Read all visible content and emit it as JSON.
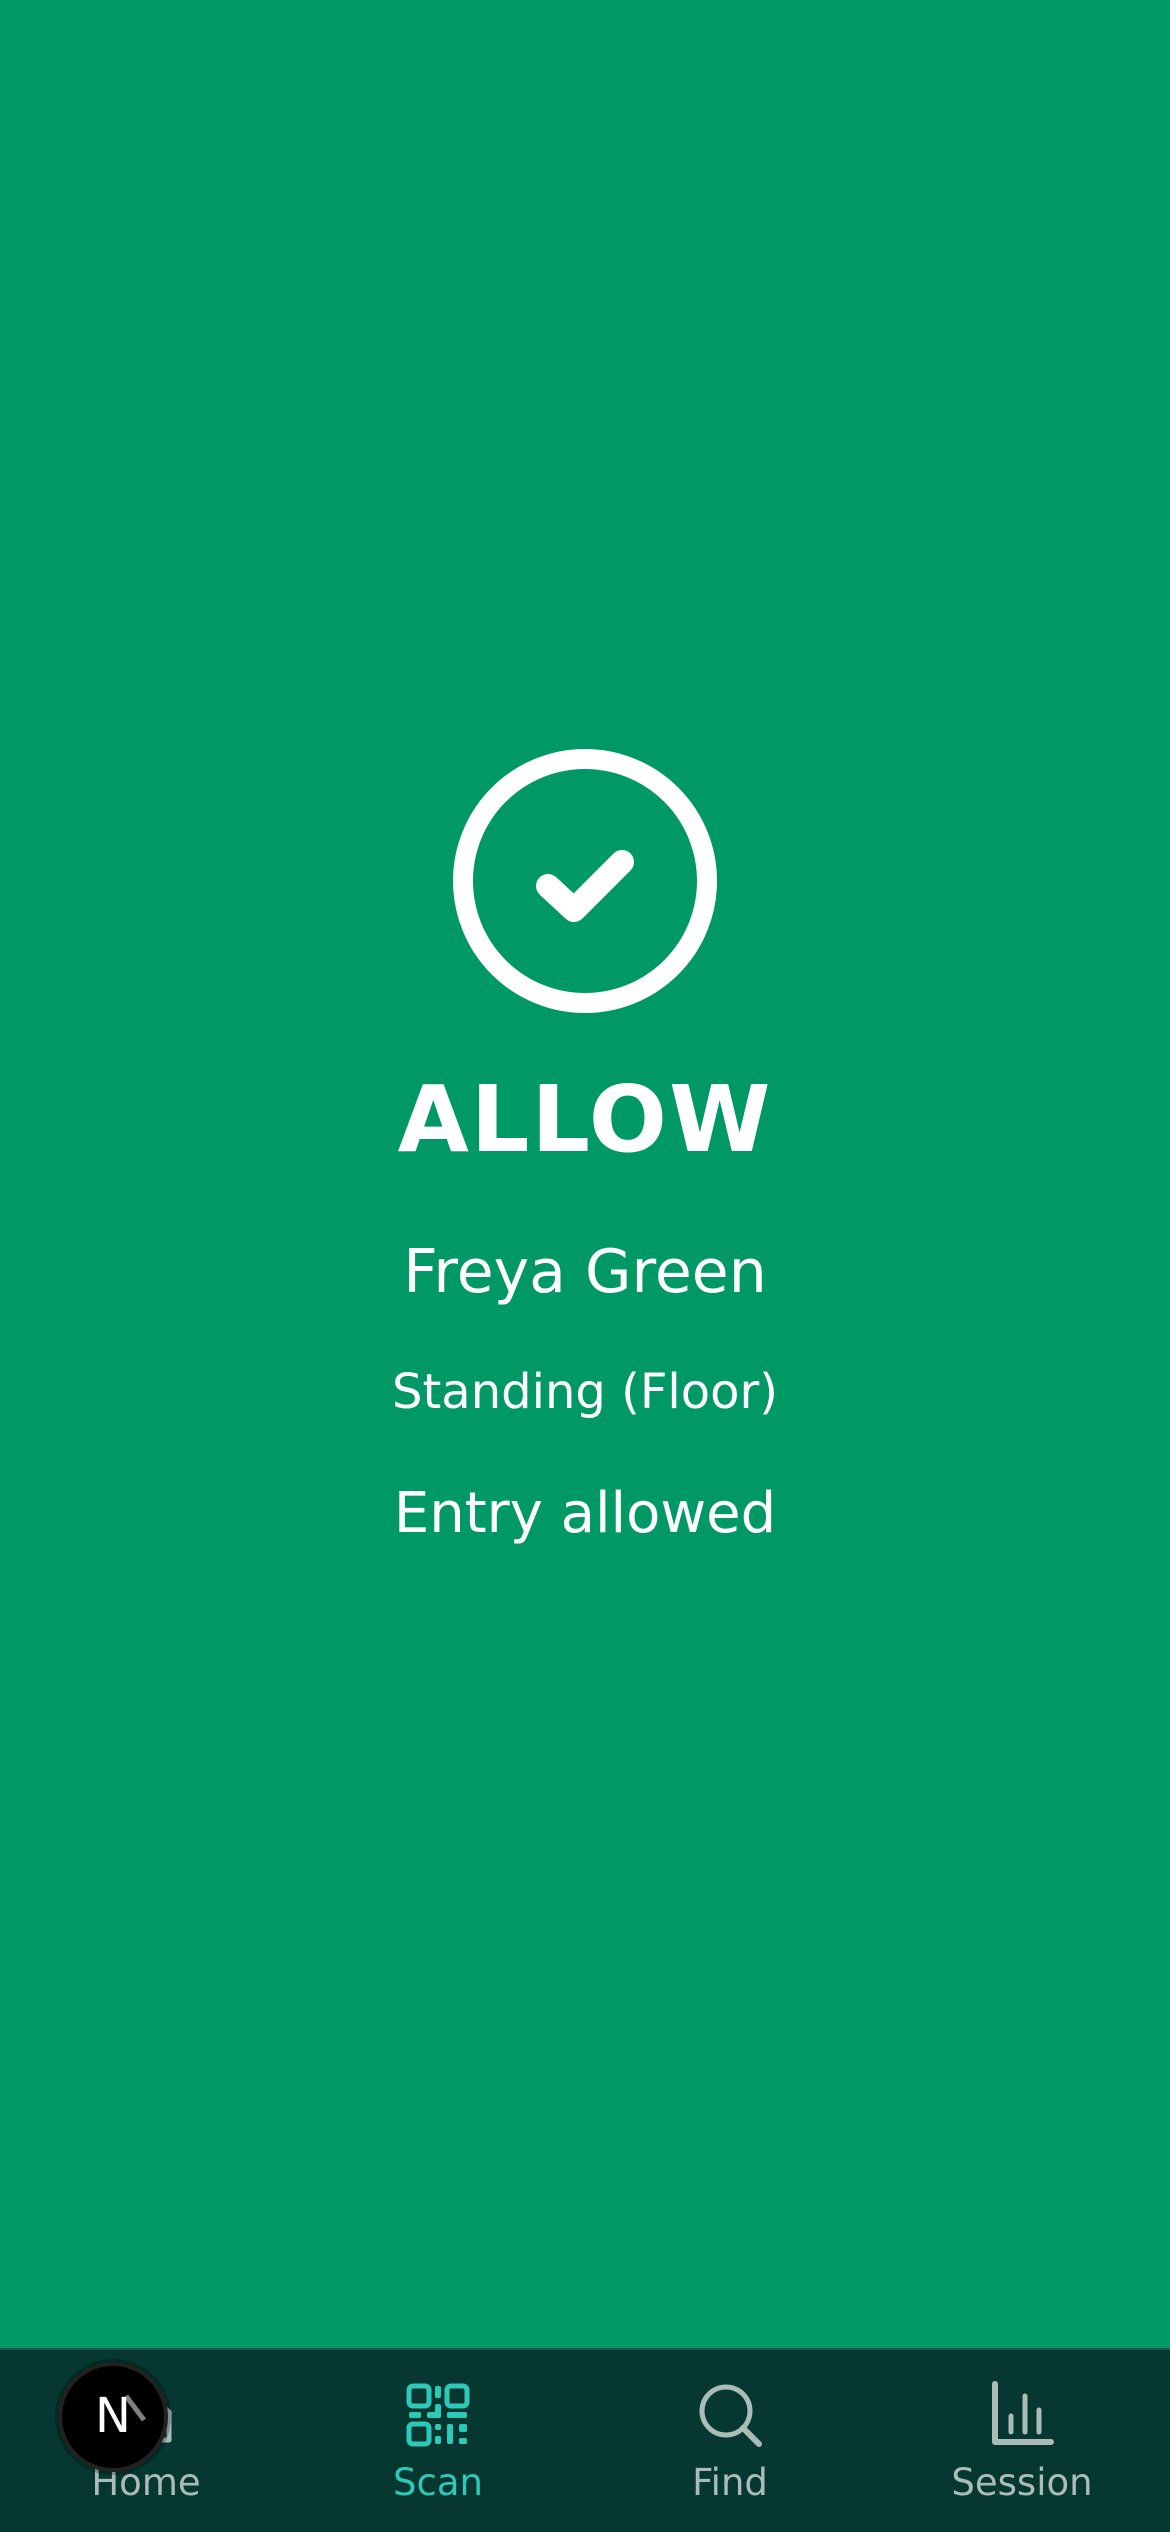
{
  "result": {
    "status": "ALLOW",
    "name": "Freya Green",
    "ticket": "Standing (Floor)",
    "message": "Entry allowed",
    "icon": "check-circle-icon",
    "background_color": "#009966"
  },
  "tabbar": {
    "tabs": [
      {
        "label": "Home",
        "icon": "home-icon",
        "active": false
      },
      {
        "label": "Scan",
        "icon": "qr-code-icon",
        "active": true
      },
      {
        "label": "Find",
        "icon": "search-icon",
        "active": false
      },
      {
        "label": "Session",
        "icon": "bar-chart-icon",
        "active": false
      }
    ],
    "active_color": "#2cc9b8",
    "inactive_color": "#a9bcb8",
    "background_color": "#073731"
  },
  "dev_badge": {
    "icon": "nextjs-logo-icon",
    "letter": "N"
  }
}
